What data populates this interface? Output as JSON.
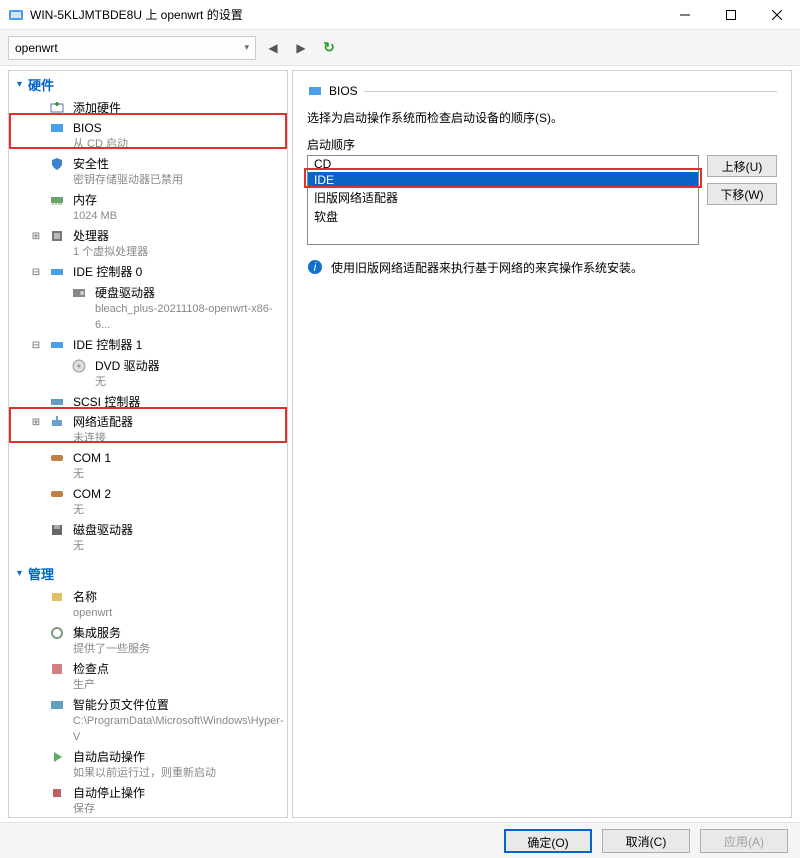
{
  "window": {
    "title": "WIN-5KLJMTBDE8U 上 openwrt 的设置",
    "vm_name": "openwrt"
  },
  "groups": {
    "hardware": "硬件",
    "management": "管理"
  },
  "hw": {
    "add": "添加硬件",
    "bios": {
      "label": "BIOS",
      "sub": "从 CD 启动"
    },
    "security": {
      "label": "安全性",
      "sub": "密钥存储驱动器已禁用"
    },
    "memory": {
      "label": "内存",
      "sub": "1024 MB"
    },
    "cpu": {
      "label": "处理器",
      "sub": "1 个虚拟处理器"
    },
    "ide0": {
      "label": "IDE 控制器 0"
    },
    "hdd": {
      "label": "硬盘驱动器",
      "sub": "bleach_plus-20211108-openwrt-x86-6..."
    },
    "ide1": {
      "label": "IDE 控制器 1"
    },
    "dvd": {
      "label": "DVD 驱动器",
      "sub": "无"
    },
    "scsi": {
      "label": "SCSI 控制器"
    },
    "net": {
      "label": "网络适配器",
      "sub": "未连接"
    },
    "com1": {
      "label": "COM 1",
      "sub": "无"
    },
    "com2": {
      "label": "COM 2",
      "sub": "无"
    },
    "floppy": {
      "label": "磁盘驱动器",
      "sub": "无"
    }
  },
  "mg": {
    "name": {
      "label": "名称",
      "sub": "openwrt"
    },
    "integ": {
      "label": "集成服务",
      "sub": "提供了一些服务"
    },
    "chk": {
      "label": "检查点",
      "sub": "生产"
    },
    "smart": {
      "label": "智能分页文件位置",
      "sub": "C:\\ProgramData\\Microsoft\\Windows\\Hyper-V"
    },
    "autostart": {
      "label": "自动启动操作",
      "sub": "如果以前运行过，则重新启动"
    },
    "autostop": {
      "label": "自动停止操作",
      "sub": "保存"
    }
  },
  "right": {
    "panel_title": "BIOS",
    "desc": "选择为启动操作系统而检查启动设备的顺序(S)。",
    "order_label": "启动顺序",
    "list": [
      "CD",
      "IDE",
      "旧版网络适配器",
      "软盘"
    ],
    "up": "上移(U)",
    "down": "下移(W)",
    "info": "使用旧版网络适配器来执行基于网络的来宾操作系统安装。"
  },
  "footer": {
    "ok": "确定(O)",
    "cancel": "取消(C)",
    "apply": "应用(A)"
  }
}
